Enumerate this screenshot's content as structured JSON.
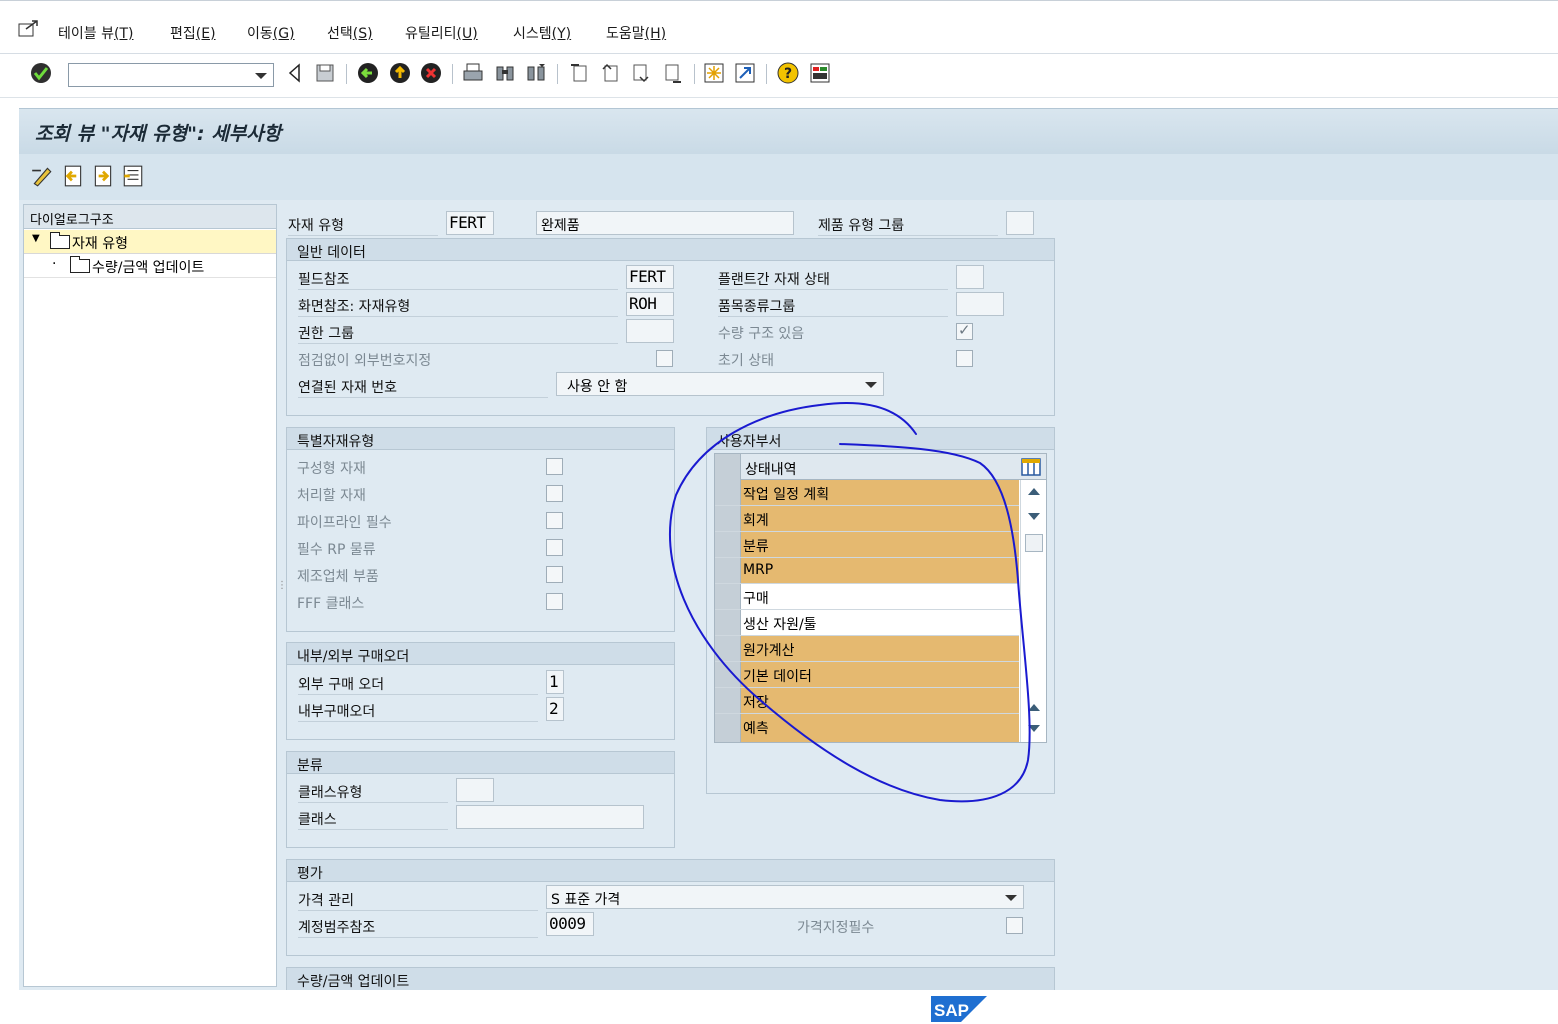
{
  "menu": [
    {
      "label": "테이블 뷰",
      "key": "(T)"
    },
    {
      "label": "편집",
      "key": "(E)"
    },
    {
      "label": "이동",
      "key": "(G)"
    },
    {
      "label": "선택",
      "key": "(S)"
    },
    {
      "label": "유틸리티",
      "key": "(U)"
    },
    {
      "label": "시스템",
      "key": "(Y)"
    },
    {
      "label": "도움말",
      "key": "(H)"
    }
  ],
  "command_field": {
    "value": ""
  },
  "title": "조회 뷰 \"자재 유형\": 세부사항",
  "tree": {
    "header": "다이얼로그구조",
    "items": [
      {
        "label": "자재 유형"
      },
      {
        "label": "수량/금액 업데이트"
      }
    ]
  },
  "header_fields": {
    "material_type_label": "자재 유형",
    "material_type_value": "FERT",
    "material_type_desc": "완제품",
    "product_group_label": "제품 유형 그룹",
    "product_group_value": ""
  },
  "general": {
    "title": "일반 데이터",
    "field_ref_label": "필드참조",
    "field_ref_value": "FERT",
    "screen_ref_label": "화면참조: 자재유형",
    "screen_ref_value": "ROH",
    "auth_group_label": "권한 그룹",
    "auth_group_value": "",
    "ext_no_label": "점검없이 외부번호지정",
    "linked_mat_label": "연결된 자재 번호",
    "linked_mat_value": "사용 안 함",
    "xplant_label": "플랜트간 자재 상태",
    "xplant_value": "",
    "item_cat_label": "품목종류그룹",
    "item_cat_value": "",
    "qty_struct_label": "수량 구조 있음",
    "init_status_label": "초기 상태"
  },
  "special": {
    "title": "특별자재유형",
    "items": [
      "구성형 자재",
      "처리할 자재",
      "파이프라인 필수",
      "필수 RP 물류",
      "제조업체 부품",
      "FFF 클래스"
    ]
  },
  "user_dept": {
    "title": "사용자부서",
    "column": "상태내역",
    "rows": [
      {
        "label": "작업 일정 계획",
        "selected": true
      },
      {
        "label": "회계",
        "selected": true
      },
      {
        "label": "분류",
        "selected": true
      },
      {
        "label": "MRP",
        "selected": true
      },
      {
        "label": "구매",
        "selected": false
      },
      {
        "label": "생산 자원/툴",
        "selected": false
      },
      {
        "label": "원가계산",
        "selected": true
      },
      {
        "label": "기본 데이터",
        "selected": true
      },
      {
        "label": "저장",
        "selected": true
      },
      {
        "label": "예측",
        "selected": true
      }
    ],
    "highlight_color": "#e5b970"
  },
  "po": {
    "title": "내부/외부 구매오더",
    "ext_label": "외부 구매 오더",
    "ext_value": "1",
    "int_label": "내부구매오더",
    "int_value": "2"
  },
  "classification": {
    "title": "분류",
    "class_type_label": "클래스유형",
    "class_type_value": "",
    "class_label": "클래스",
    "class_value": ""
  },
  "valuation": {
    "title": "평가",
    "price_ctrl_label": "가격 관리",
    "price_ctrl_value": "S 표준 가격",
    "acct_cat_label": "계정범주참조",
    "acct_cat_value": "0009",
    "price_det_label": "가격지정필수"
  },
  "qty_value_update": {
    "title": "수량/금액 업데이트"
  },
  "footer": {
    "logo": "SAP"
  },
  "colors": {
    "accent_blue": "#1010c8",
    "title_bg": "#d9e6ef"
  }
}
